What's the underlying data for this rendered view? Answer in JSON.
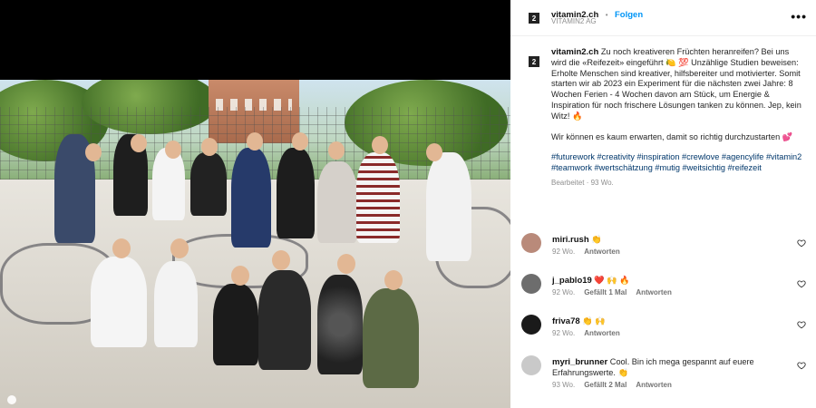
{
  "post": {
    "username": "vitamin2.ch",
    "separator": "•",
    "follow_label": "Folgen",
    "subtitle": "VITAMIN2 AG",
    "more_icon": "more-horizontal-icon"
  },
  "caption": {
    "username": "vitamin2.ch",
    "text1": "Zu noch kreativeren Früchten heranreifen? Bei uns wird die «Reifezeit» eingeführt 🍋 💯 Unzählige Studien beweisen: Erholte Menschen sind kreativer, hilfsbereiter und motivierter. Somit starten wir ab 2023 ein Experiment für die nächsten zwei Jahre: 8 Wochen Ferien - 4 Wochen davon am Stück, um Energie & Inspiration für noch frischere Lösungen tanken zu können. Jep, kein Witz! 🔥",
    "text2": "Wir können es kaum erwarten, damit so richtig durchzustarten 💕",
    "hashtags": "#futurework #creativity #inspiration #crewlove #agencylife #vitamin2 #teamwork #wertschätzung #mutig #weitsichtig #reifezeit",
    "meta": "Bearbeitet · 93 Wo."
  },
  "comments": [
    {
      "username": "miri.rush",
      "text": "👏",
      "time": "92 Wo.",
      "likes": "",
      "reply": "Antworten",
      "avatar_color": "#b98a7a"
    },
    {
      "username": "j_pablo19",
      "text": "❤️ 🙌 🔥",
      "time": "92 Wo.",
      "likes": "Gefällt 1 Mal",
      "reply": "Antworten",
      "avatar_color": "#6d6d6d"
    },
    {
      "username": "friva78",
      "text": "👏 🙌",
      "time": "92 Wo.",
      "likes": "",
      "reply": "Antworten",
      "avatar_color": "#1a1a1a"
    },
    {
      "username": "myri_brunner",
      "text": "Cool. Bin ich mega gespannt auf euere Erfahrungswerte. 👏",
      "time": "93 Wo.",
      "likes": "Gefällt 2 Mal",
      "reply": "Antworten",
      "avatar_color": "#c9c9c9"
    }
  ],
  "icons": {
    "heart": "heart-outline-icon",
    "brand": "vitamin2-logo-icon"
  }
}
